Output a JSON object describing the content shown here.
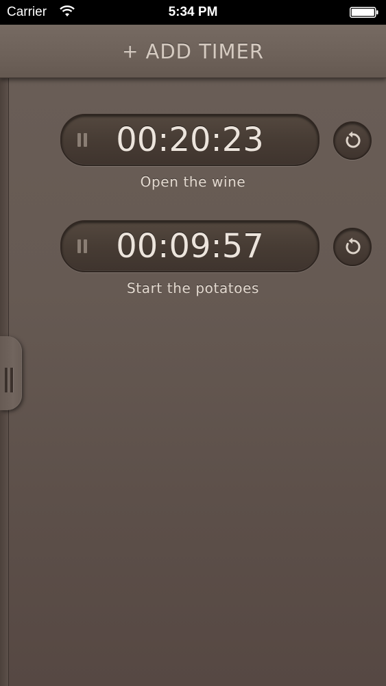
{
  "status_bar": {
    "carrier": "Carrier",
    "time": "5:34 PM"
  },
  "header": {
    "add_timer_plus": "+",
    "add_timer_label": "ADD TIMER"
  },
  "timers": [
    {
      "time": "00:20:23",
      "label": "Open the wine"
    },
    {
      "time": "00:09:57",
      "label": "Start the potatoes"
    }
  ],
  "icons": {
    "wifi": "wifi-icon",
    "battery": "battery-icon",
    "pause": "pause-icon",
    "reset": "reset-icon",
    "drawer": "drawer-handle-icon"
  },
  "colors": {
    "background": "#665a53",
    "header": "#6e625a",
    "timer_pill": "#473c34",
    "timer_text": "#ece4dc",
    "label_text": "#e4dad0",
    "header_text": "#d6cbc1"
  }
}
